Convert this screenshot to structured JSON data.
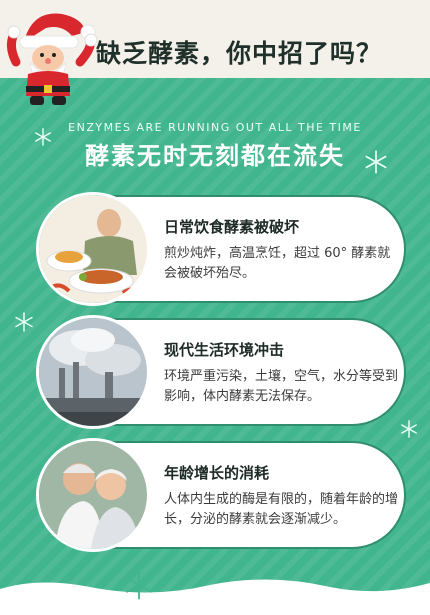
{
  "header": {
    "headline": "缺乏酵素，你中招了吗？",
    "english_subtitle": "ENZYMES ARE RUNNING OUT ALL THE TIME",
    "section_title": "酵素无时无刻都在流失"
  },
  "cards": [
    {
      "title": "日常饮食酵素被破坏",
      "text": "煎炒炖炸，高温烹饪，超过 60° 酵素就会被破坏殆尽。",
      "image": "food-photo"
    },
    {
      "title": "现代生活环境冲击",
      "text": "环境严重污染，土壤，空气，水分等受到影响，体内酵素无法保存。",
      "image": "factory-smokestack-photo"
    },
    {
      "title": "年龄增长的消耗",
      "text": "人体内生成的酶是有限的，随着年龄的增长，分泌的酵素就会逐渐减少。",
      "image": "elderly-couple-photo"
    }
  ],
  "colors": {
    "green": "#41b58e",
    "cream": "#f4f1ea",
    "card_border": "#2f8e6e",
    "santa_red": "#d8282e"
  }
}
